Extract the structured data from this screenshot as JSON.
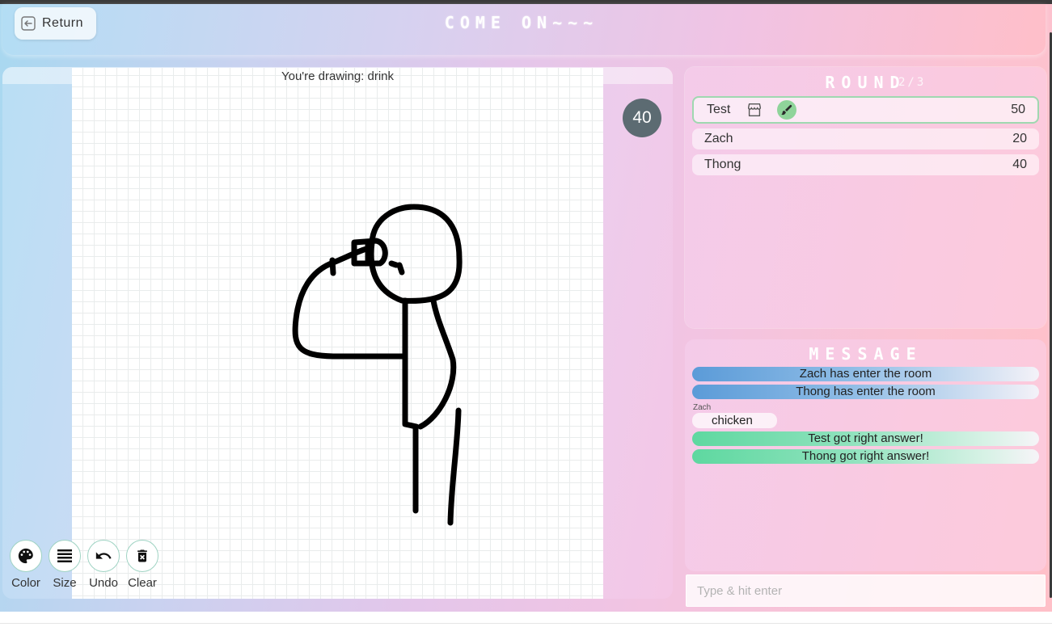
{
  "header": {
    "return_label": "Return",
    "title": "COME ON~~~"
  },
  "canvas": {
    "drawing_prefix": "You're drawing: drink",
    "timer": "40"
  },
  "tools": [
    {
      "label": "Color",
      "icon": "palette-icon"
    },
    {
      "label": "Size",
      "icon": "lines-icon"
    },
    {
      "label": "Undo",
      "icon": "undo-icon"
    },
    {
      "label": "Clear",
      "icon": "trash-icon"
    }
  ],
  "round": {
    "title": "ROUND",
    "count": "2/3",
    "players": [
      {
        "name": "Test",
        "score": "50",
        "is_drawer": true,
        "icons": [
          "store-icon",
          "brush-icon"
        ]
      },
      {
        "name": "Zach",
        "score": "20",
        "is_drawer": false
      },
      {
        "name": "Thong",
        "score": "40",
        "is_drawer": false
      }
    ]
  },
  "messages": {
    "title": "MESSAGE",
    "system_join": [
      "Zach has enter the room",
      "Thong has enter the room"
    ],
    "chat": {
      "sender": "Zach",
      "text": "chicken"
    },
    "system_right": [
      "Test got right answer!",
      "Thong got right answer!"
    ]
  },
  "chat_input": {
    "placeholder": "Type & hit enter",
    "value": ""
  },
  "colors": {
    "accent_green": "#8fd49a",
    "timer_bg": "#5c6b72",
    "join_blue": "#5b9bd8",
    "right_green": "#5ed8a0"
  }
}
